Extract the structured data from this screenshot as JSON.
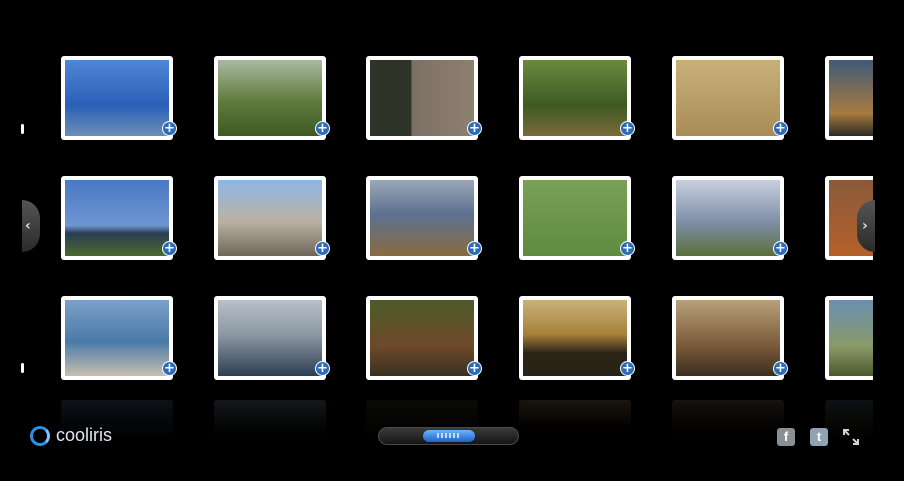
{
  "brand": {
    "name": "cooliris",
    "accent": "#2f8fe0"
  },
  "gallery": {
    "add_icon": "+",
    "photos": [
      "Man standing by the sea",
      "Sunlit park trees",
      "Man at stone doorway",
      "Woodland path",
      "Hay bale in field",
      "Dusk landscape",
      "Coastline horizon",
      "Old cannon and castle",
      "Rocky cove",
      "Deer grazing",
      "Coastal fields",
      "Red hillside",
      "Rock formation by sea",
      "Headland across water",
      "Man seated on bench",
      "Sunset over sea",
      "Sunset over farmland",
      "Road sign"
    ]
  },
  "controls": {
    "prev_arrow": "‹",
    "next_arrow": "›",
    "facebook_label": "f",
    "twitter_label": "t",
    "icons": [
      "facebook-icon",
      "twitter-icon",
      "fullscreen-icon"
    ]
  }
}
